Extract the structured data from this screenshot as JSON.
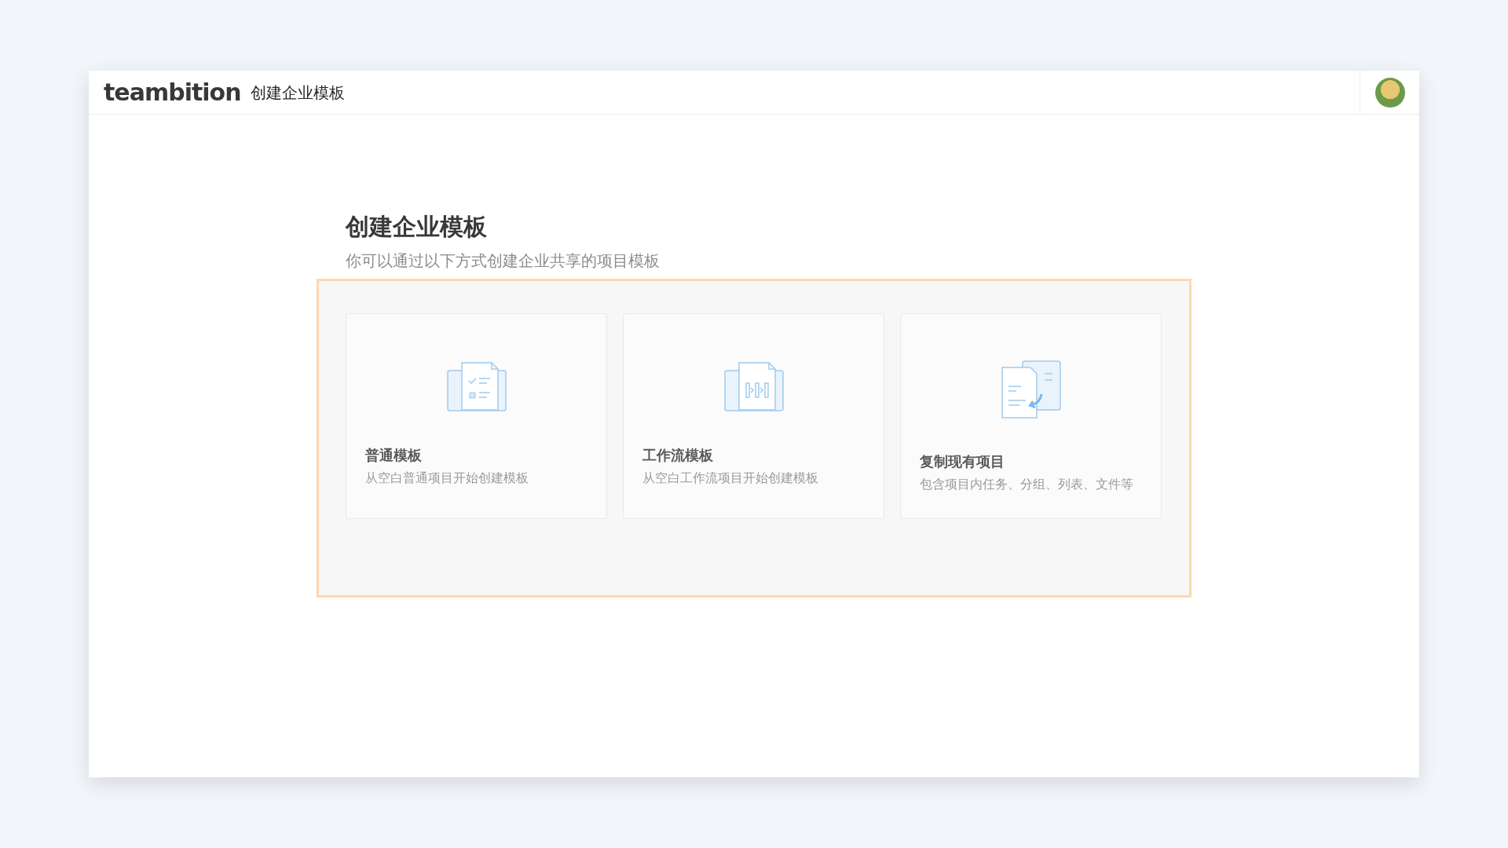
{
  "header": {
    "logo": "teambition",
    "title": "创建企业模板"
  },
  "page": {
    "title": "创建企业模板",
    "subtitle": "你可以通过以下方式创建企业共享的项目模板"
  },
  "options": [
    {
      "kind": "checklist",
      "title": "普通模板",
      "description": "从空白普通项目开始创建模板"
    },
    {
      "kind": "workflow",
      "title": "工作流模板",
      "description": "从空白工作流项目开始创建模板"
    },
    {
      "kind": "copy",
      "title": "复制现有项目",
      "description": "包含项目内任务、分组、列表、文件等"
    }
  ]
}
